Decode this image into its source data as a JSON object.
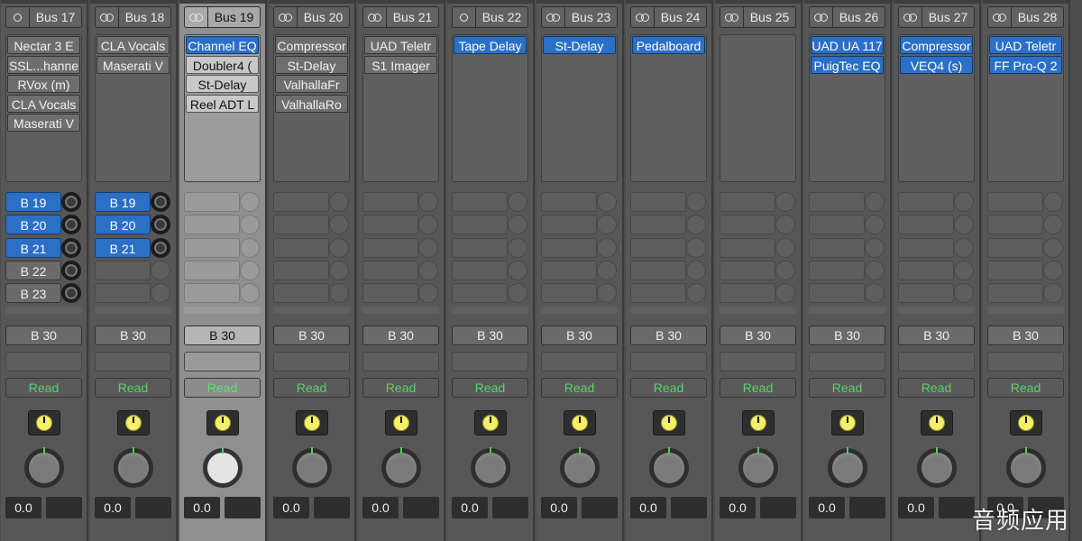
{
  "strips": [
    {
      "name": "Bus 17",
      "link": "single",
      "selected": false,
      "inserts": [
        {
          "label": "Nectar 3 E",
          "style": "gray"
        },
        {
          "label": "SSL...hanne",
          "style": "gray"
        },
        {
          "label": "RVox (m)",
          "style": "gray"
        },
        {
          "label": "CLA Vocals",
          "style": "gray"
        },
        {
          "label": "Maserati V",
          "style": "gray"
        }
      ],
      "sends": [
        {
          "label": "B 19",
          "style": "blue"
        },
        {
          "label": "B 20",
          "style": "blue"
        },
        {
          "label": "B 21",
          "style": "blue"
        },
        {
          "label": "B 22",
          "style": "gray"
        },
        {
          "label": "B 23",
          "style": "gray"
        }
      ],
      "output": "B 30",
      "automation": "Read",
      "volume": "0.0"
    },
    {
      "name": "Bus 18",
      "link": "double",
      "selected": false,
      "inserts": [
        {
          "label": "CLA Vocals",
          "style": "gray"
        },
        {
          "label": "Maserati V",
          "style": "gray"
        }
      ],
      "sends": [
        {
          "label": "B 19",
          "style": "blue"
        },
        {
          "label": "B 20",
          "style": "blue"
        },
        {
          "label": "B 21",
          "style": "blue"
        }
      ],
      "output": "B 30",
      "automation": "Read",
      "volume": "0.0"
    },
    {
      "name": "Bus 19",
      "link": "double",
      "selected": true,
      "inserts": [
        {
          "label": "Channel EQ",
          "style": "blue"
        },
        {
          "label": "Doubler4 (",
          "style": "gray"
        },
        {
          "label": "St-Delay",
          "style": "gray"
        },
        {
          "label": "Reel ADT L",
          "style": "gray"
        }
      ],
      "sends": [],
      "output": "B 30",
      "automation": "Read",
      "volume": "0.0"
    },
    {
      "name": "Bus 20",
      "link": "double",
      "selected": false,
      "inserts": [
        {
          "label": "Compressor",
          "style": "gray"
        },
        {
          "label": "St-Delay",
          "style": "gray"
        },
        {
          "label": "ValhallaFr",
          "style": "gray"
        },
        {
          "label": "ValhallaRo",
          "style": "gray"
        }
      ],
      "sends": [],
      "output": "B 30",
      "automation": "Read",
      "volume": "0.0"
    },
    {
      "name": "Bus 21",
      "link": "double",
      "selected": false,
      "inserts": [
        {
          "label": "UAD Teletr",
          "style": "gray"
        },
        {
          "label": "S1 Imager",
          "style": "gray"
        }
      ],
      "sends": [],
      "output": "B 30",
      "automation": "Read",
      "volume": "0.0"
    },
    {
      "name": "Bus 22",
      "link": "single",
      "selected": false,
      "inserts": [
        {
          "label": "Tape Delay",
          "style": "blue"
        }
      ],
      "sends": [],
      "output": "B 30",
      "automation": "Read",
      "volume": "0.0"
    },
    {
      "name": "Bus 23",
      "link": "double",
      "selected": false,
      "inserts": [
        {
          "label": "St-Delay",
          "style": "blue"
        }
      ],
      "sends": [],
      "output": "B 30",
      "automation": "Read",
      "volume": "0.0"
    },
    {
      "name": "Bus 24",
      "link": "double",
      "selected": false,
      "inserts": [
        {
          "label": "Pedalboard",
          "style": "blue"
        }
      ],
      "sends": [],
      "output": "B 30",
      "automation": "Read",
      "volume": "0.0"
    },
    {
      "name": "Bus 25",
      "link": "double",
      "selected": false,
      "inserts": [],
      "sends": [],
      "output": "B 30",
      "automation": "Read",
      "volume": "0.0"
    },
    {
      "name": "Bus 26",
      "link": "double",
      "selected": false,
      "inserts": [
        {
          "label": "UAD UA 117",
          "style": "blue"
        },
        {
          "label": "PuigTec EQ",
          "style": "blue"
        }
      ],
      "sends": [],
      "output": "B 30",
      "automation": "Read",
      "volume": "0.0"
    },
    {
      "name": "Bus 27",
      "link": "double",
      "selected": false,
      "inserts": [
        {
          "label": "Compressor",
          "style": "blue"
        },
        {
          "label": "VEQ4 (s)",
          "style": "blue"
        }
      ],
      "sends": [],
      "output": "B 30",
      "automation": "Read",
      "volume": "0.0"
    },
    {
      "name": "Bus 28",
      "link": "double",
      "selected": false,
      "inserts": [
        {
          "label": "UAD Teletr",
          "style": "blue"
        },
        {
          "label": "FF Pro-Q 2",
          "style": "blue"
        }
      ],
      "sends": [],
      "output": "B 30",
      "automation": "Read",
      "volume": "0.0"
    }
  ],
  "watermark": "音频应用",
  "colors": {
    "strip_bg": "#575757",
    "strip_selected_bg": "#8f8f8f",
    "insert_blue": "#2b6fc6",
    "automation_read": "#58d36a",
    "gain_knob": "#f4f06a",
    "pan_marker": "#4ecf5c"
  }
}
